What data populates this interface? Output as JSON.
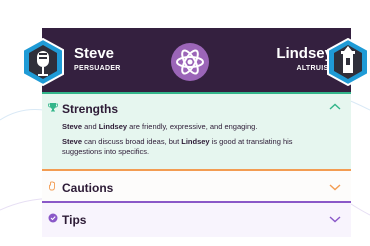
{
  "header": {
    "left_name": "Steve",
    "left_type": "PERSUADER",
    "right_name": "Lindsey",
    "right_type": "ALTRUIST",
    "center_icon": "atom-icon",
    "left_avatar_icon": "microphone-icon",
    "right_avatar_icon": "lighthouse-icon"
  },
  "sections": [
    {
      "title": "Strengths",
      "icon": "trophy-icon",
      "expanded": true,
      "color": "#33b58a",
      "lines": [
        {
          "parts": [
            {
              "b": "Steve"
            },
            {
              "t": " and "
            },
            {
              "b": "Lindsey"
            },
            {
              "t": " are friendly, expressive, and engaging."
            }
          ]
        },
        {
          "parts": [
            {
              "b": "Steve"
            },
            {
              "t": " can discuss broad ideas, but "
            },
            {
              "b": "Lindsey"
            },
            {
              "t": " is good at translating his suggestions into specifics."
            }
          ]
        }
      ]
    },
    {
      "title": "Cautions",
      "icon": "hand-icon",
      "expanded": false,
      "color": "#f39c52"
    },
    {
      "title": "Tips",
      "icon": "check-circle-icon",
      "expanded": false,
      "color": "#8a58c8"
    }
  ],
  "colors": {
    "header_bg": "#34203f",
    "badge": "#9b65b8",
    "text_dark": "#2d1b36"
  }
}
